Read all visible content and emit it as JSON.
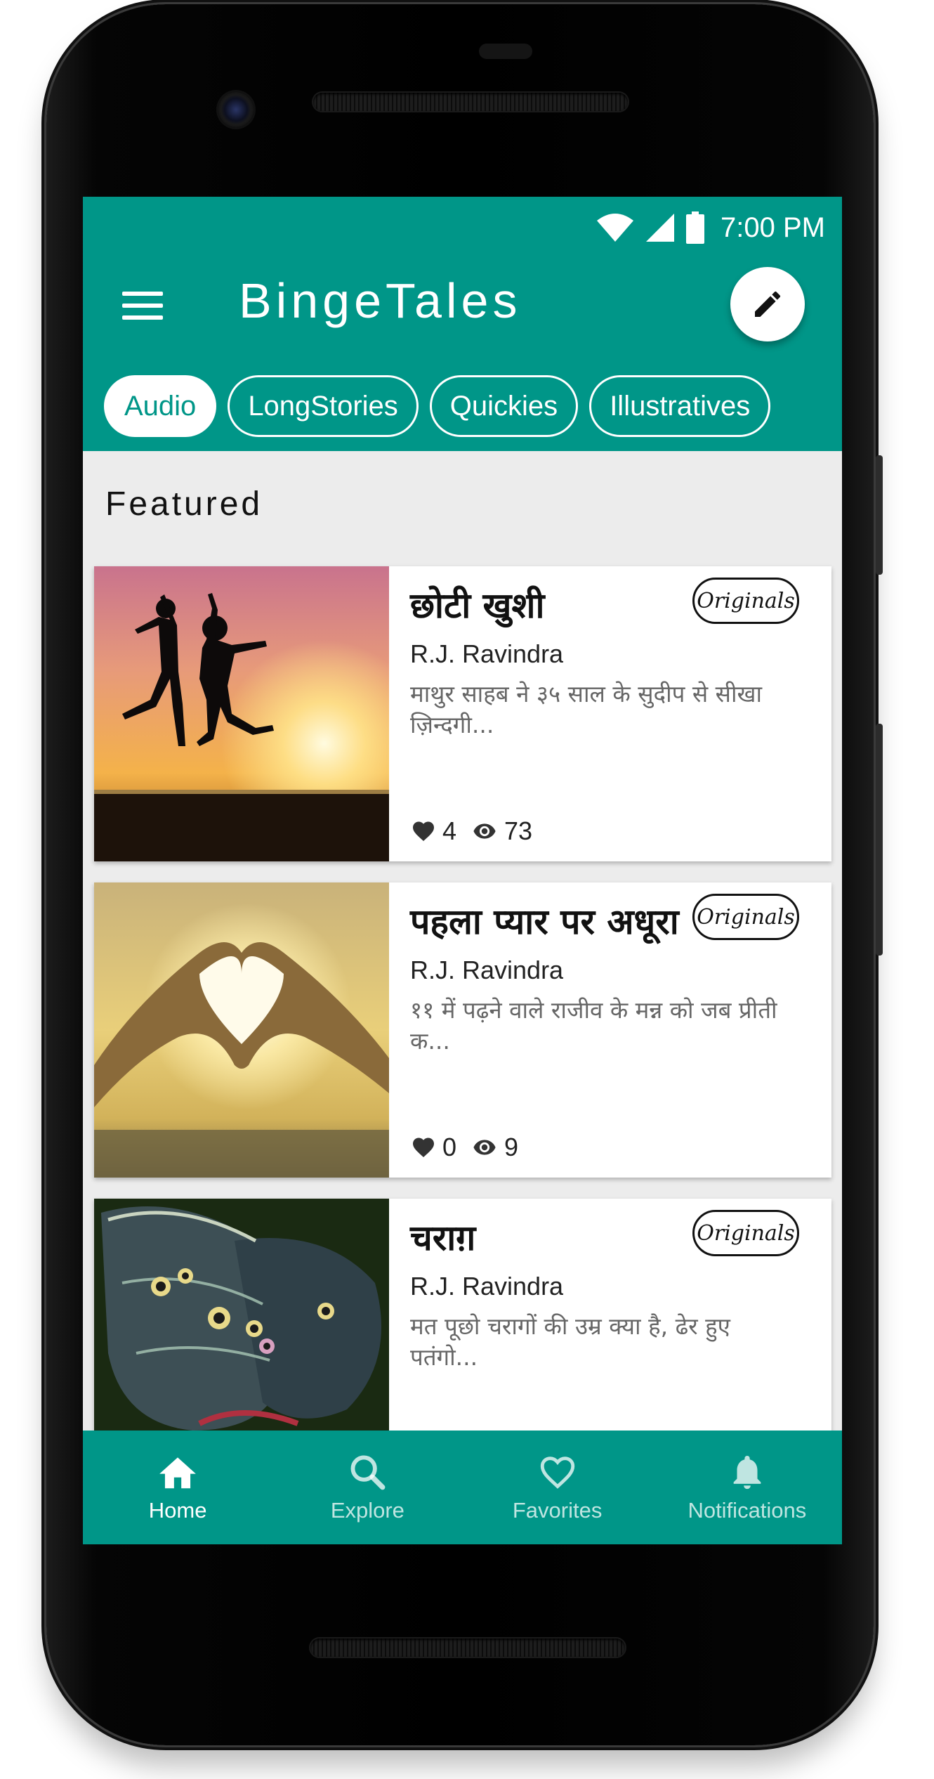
{
  "status": {
    "time": "7:00 PM",
    "icons": [
      "wifi-icon",
      "signal-icon",
      "battery-icon"
    ]
  },
  "app": {
    "title": "BingeTales",
    "menu_icon": "hamburger-menu-icon",
    "fab_icon": "pencil-edit-icon"
  },
  "tabs": [
    {
      "label": "Audio",
      "active": true
    },
    {
      "label": "LongStories",
      "active": false
    },
    {
      "label": "Quickies",
      "active": false
    },
    {
      "label": "Illustratives",
      "active": false
    }
  ],
  "section": {
    "title": "Featured"
  },
  "stories": [
    {
      "title": "छोटी खुशी",
      "badge": "Originals",
      "author": "R.J. Ravindra",
      "description": "माथुर साहब ने ३५ साल के सुदीप से सीखा ज़िन्दगी...",
      "likes": "4",
      "views": "73",
      "image": "silhouettes-jumping-at-sunset"
    },
    {
      "title": "पहला प्यार पर अधूरा",
      "badge": "Originals",
      "author": "R.J. Ravindra",
      "description": "११ में पढ़ने वाले राजीव के मन्न को जब प्रीती क...",
      "likes": "0",
      "views": "9",
      "image": "heart-hands-at-sunset"
    },
    {
      "title": "चराग़",
      "badge": "Originals",
      "author": "R.J. Ravindra",
      "description": "मत पूछो चरागों की उम्र क्या है, ढेर हुए पतंगो...",
      "image": "butterfly-wings"
    }
  ],
  "bottom_nav": [
    {
      "label": "Home",
      "icon": "home-icon",
      "active": true
    },
    {
      "label": "Explore",
      "icon": "search-icon",
      "active": false
    },
    {
      "label": "Favorites",
      "icon": "heart-outline-icon",
      "active": false
    },
    {
      "label": "Notifications",
      "icon": "bell-icon",
      "active": false
    }
  ],
  "colors": {
    "primary": "#009688",
    "background": "#ececec",
    "card": "#ffffff"
  }
}
